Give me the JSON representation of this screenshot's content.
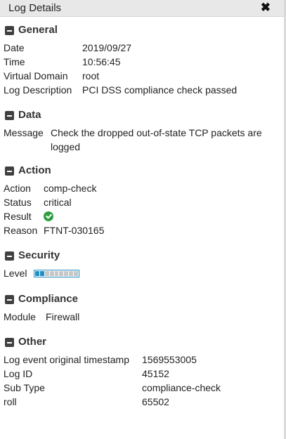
{
  "window": {
    "title": "Log Details",
    "close_icon": "close-icon"
  },
  "sections": {
    "general": {
      "title": "General",
      "rows": [
        {
          "label": "Date",
          "value": "2019/09/27"
        },
        {
          "label": "Time",
          "value": "10:56:45"
        },
        {
          "label": "Virtual Domain",
          "value": "root"
        },
        {
          "label": "Log Description",
          "value": "PCI DSS compliance check passed"
        }
      ]
    },
    "data": {
      "title": "Data",
      "rows": [
        {
          "label": "Message",
          "value": "Check the dropped out-of-state TCP packets are logged"
        }
      ]
    },
    "action": {
      "title": "Action",
      "rows": [
        {
          "label": "Action",
          "value": "comp-check"
        },
        {
          "label": "Status",
          "value": "critical"
        },
        {
          "label": "Result",
          "icon": "check-circle-icon",
          "icon_color": "#2e9e3e"
        },
        {
          "label": "Reason",
          "value": "FTNT-030165"
        }
      ]
    },
    "security": {
      "title": "Security",
      "rows": [
        {
          "label": "Level",
          "level_filled": 2,
          "level_total": 9,
          "level_color": "#1f8fc2"
        }
      ]
    },
    "compliance": {
      "title": "Compliance",
      "rows": [
        {
          "label": "Module",
          "value": "Firewall"
        }
      ]
    },
    "other": {
      "title": "Other",
      "rows": [
        {
          "label": "Log event original timestamp",
          "value": "1569553005"
        },
        {
          "label": "Log ID",
          "value": "45152"
        },
        {
          "label": "Sub Type",
          "value": "compliance-check"
        },
        {
          "label": "roll",
          "value": "65502"
        }
      ]
    }
  }
}
